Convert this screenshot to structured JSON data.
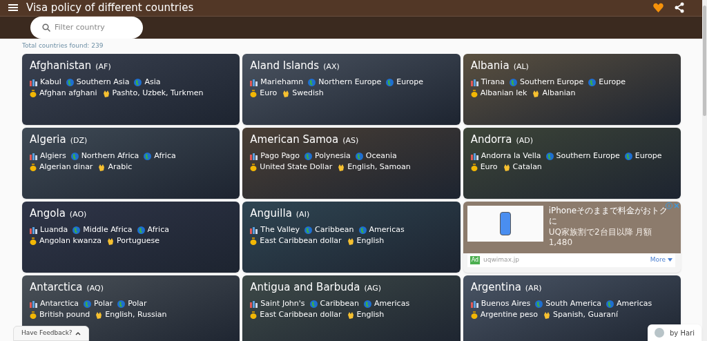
{
  "app_bar": {
    "title": "Visa policy of different countries"
  },
  "search": {
    "placeholder": "Filter country"
  },
  "total": "Total countries found: 239",
  "cards": [
    {
      "kind": "country",
      "name": "Afghanistan",
      "code": "(AF)",
      "capital": "Kabul",
      "subregion": "Southern Asia",
      "region": "Asia",
      "currency": "Afghan afghani",
      "languages": "Pashto, Uzbek, Turkmen"
    },
    {
      "kind": "country",
      "name": "Aland Islands",
      "code": "(AX)",
      "capital": "Mariehamn",
      "subregion": "Northern Europe",
      "region": "Europe",
      "currency": "Euro",
      "languages": "Swedish"
    },
    {
      "kind": "country",
      "name": "Albania",
      "code": "(AL)",
      "capital": "Tirana",
      "subregion": "Southern Europe",
      "region": "Europe",
      "currency": "Albanian lek",
      "languages": "Albanian"
    },
    {
      "kind": "country",
      "name": "Algeria",
      "code": "(DZ)",
      "capital": "Algiers",
      "subregion": "Northern Africa",
      "region": "Africa",
      "currency": "Algerian dinar",
      "languages": "Arabic"
    },
    {
      "kind": "country",
      "name": "American Samoa",
      "code": "(AS)",
      "capital": "Pago Pago",
      "subregion": "Polynesia",
      "region": "Oceania",
      "currency": "United State Dollar",
      "languages": "English, Samoan"
    },
    {
      "kind": "country",
      "name": "Andorra",
      "code": "(AD)",
      "capital": "Andorra la Vella",
      "subregion": "Southern Europe",
      "region": "Europe",
      "currency": "Euro",
      "languages": "Catalan"
    },
    {
      "kind": "country",
      "name": "Angola",
      "code": "(AO)",
      "capital": "Luanda",
      "subregion": "Middle Africa",
      "region": "Africa",
      "currency": "Angolan kwanza",
      "languages": "Portuguese"
    },
    {
      "kind": "country",
      "name": "Anguilla",
      "code": "(AI)",
      "capital": "The Valley",
      "subregion": "Caribbean",
      "region": "Americas",
      "currency": "East Caribbean dollar",
      "languages": "English"
    },
    {
      "kind": "ad",
      "headline": "iPhoneそのままで料金がおトクに",
      "description": "UQ家族割で2台目以降 月額1,480",
      "badge": "Ad",
      "domain": "uqwimax.jp",
      "more": "More"
    },
    {
      "kind": "country",
      "name": "Antarctica",
      "code": "(AQ)",
      "capital": "Antarctica",
      "subregion": "Polar",
      "region": "Polar",
      "currency": "British pound",
      "languages": "English, Russian"
    },
    {
      "kind": "country",
      "name": "Antigua and Barbuda",
      "code": "(AG)",
      "capital": "Saint John's",
      "subregion": "Caribbean",
      "region": "Americas",
      "currency": "East Caribbean dollar",
      "languages": "English"
    },
    {
      "kind": "country",
      "name": "Argentina",
      "code": "(AR)",
      "capital": "Buenos Aires",
      "subregion": "South America",
      "region": "Americas",
      "currency": "Argentine peso",
      "languages": "Spanish, Guaraní"
    }
  ],
  "feedback": {
    "label": "Have Feedback?"
  },
  "author": {
    "label": "by Hari"
  }
}
